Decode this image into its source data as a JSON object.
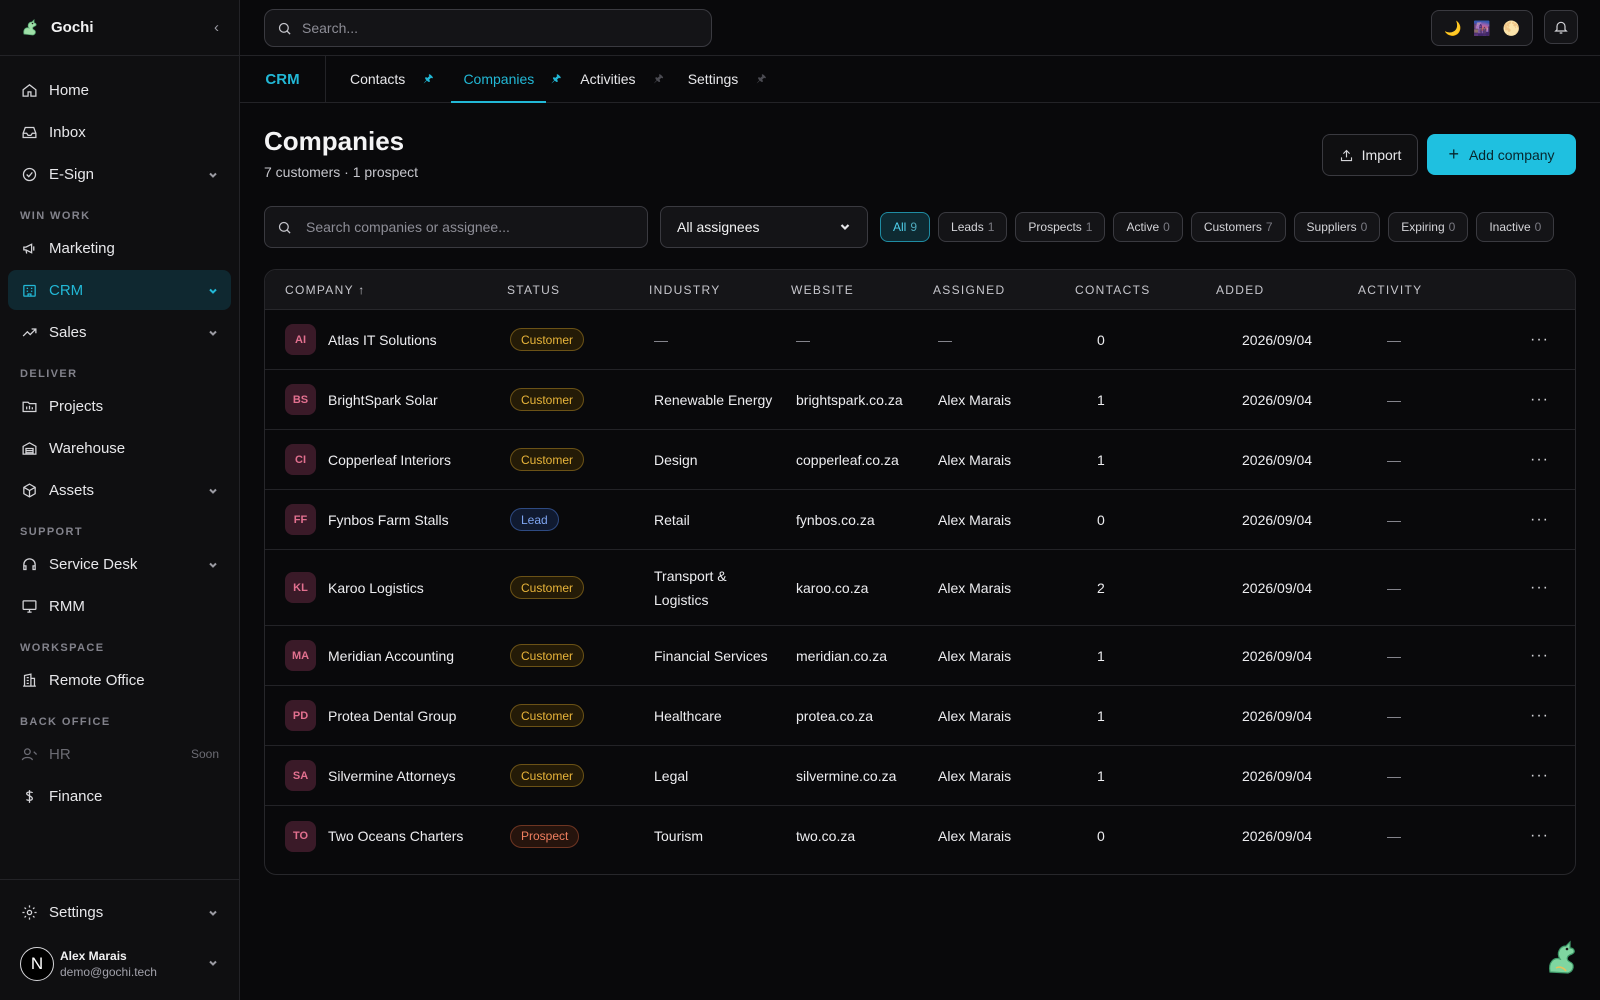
{
  "app": {
    "name": "Gochi"
  },
  "sidebar": {
    "main": [
      {
        "label": "Home",
        "icon": "home-icon"
      },
      {
        "label": "Inbox",
        "icon": "inbox-icon"
      },
      {
        "label": "E-Sign",
        "icon": "check-circle-icon"
      }
    ],
    "sections": {
      "win_work": "WIN WORK",
      "deliver": "DELIVER",
      "support": "SUPPORT",
      "workspace": "WORKSPACE",
      "back_office": "BACK OFFICE"
    },
    "win_work": [
      {
        "label": "Marketing",
        "icon": "megaphone-icon"
      },
      {
        "label": "CRM",
        "icon": "building-icon"
      },
      {
        "label": "Sales",
        "icon": "trend-up-icon"
      }
    ],
    "deliver": [
      {
        "label": "Projects",
        "icon": "folder-icon"
      },
      {
        "label": "Warehouse",
        "icon": "warehouse-icon"
      },
      {
        "label": "Assets",
        "icon": "box-icon"
      }
    ],
    "support": [
      {
        "label": "Service Desk",
        "icon": "headset-icon"
      },
      {
        "label": "RMM",
        "icon": "monitor-icon"
      }
    ],
    "workspace": [
      {
        "label": "Remote Office",
        "icon": "office-icon"
      }
    ],
    "back_office": [
      {
        "label": "HR",
        "icon": "user-icon",
        "tag": "Soon"
      },
      {
        "label": "Finance",
        "icon": "dollar-icon"
      }
    ],
    "settings": {
      "label": "Settings"
    },
    "user": {
      "initial": "N",
      "name": "Alex Marais",
      "email": "demo@gochi.tech"
    }
  },
  "topbar": {
    "search_placeholder": "Search...",
    "theme_icons": [
      "🌙",
      "🌆",
      "🌕"
    ]
  },
  "tabs": {
    "module": "CRM",
    "items": [
      {
        "label": "Contacts",
        "pinned": true
      },
      {
        "label": "Companies",
        "pinned": true,
        "active": true
      },
      {
        "label": "Activities",
        "pinned": false
      },
      {
        "label": "Settings",
        "pinned": false
      }
    ]
  },
  "page": {
    "title": "Companies",
    "subtitle": "7 customers · 1 prospect",
    "import_label": "Import",
    "add_label": "Add company"
  },
  "filters": {
    "search_placeholder": "Search companies or assignee...",
    "assignee": "All assignees",
    "chips": [
      {
        "label": "All",
        "count": "9",
        "active": true
      },
      {
        "label": "Leads",
        "count": "1"
      },
      {
        "label": "Prospects",
        "count": "1"
      },
      {
        "label": "Active",
        "count": "0"
      },
      {
        "label": "Customers",
        "count": "7"
      },
      {
        "label": "Suppliers",
        "count": "0"
      },
      {
        "label": "Expiring",
        "count": "0"
      },
      {
        "label": "Inactive",
        "count": "0"
      }
    ]
  },
  "table": {
    "columns": [
      "COMPANY ↑",
      "STATUS",
      "INDUSTRY",
      "WEBSITE",
      "ASSIGNED",
      "CONTACTS",
      "ADDED",
      "ACTIVITY"
    ],
    "rows": [
      {
        "initials": "AI",
        "company": "Atlas IT Solutions",
        "status": "Customer",
        "industry": "—",
        "website": "—",
        "assigned": "—",
        "contacts": "0",
        "added": "2026/09/04",
        "activity": "—"
      },
      {
        "initials": "BS",
        "company": "BrightSpark Solar",
        "status": "Customer",
        "industry": "Renewable Energy",
        "website": "brightspark.co.za",
        "assigned": "Alex Marais",
        "contacts": "1",
        "added": "2026/09/04",
        "activity": "—"
      },
      {
        "initials": "CI",
        "company": "Copperleaf Interiors",
        "status": "Customer",
        "industry": "Design",
        "website": "copperleaf.co.za",
        "assigned": "Alex Marais",
        "contacts": "1",
        "added": "2026/09/04",
        "activity": "—"
      },
      {
        "initials": "FF",
        "company": "Fynbos Farm Stalls",
        "status": "Lead",
        "industry": "Retail",
        "website": "fynbos.co.za",
        "assigned": "Alex Marais",
        "contacts": "0",
        "added": "2026/09/04",
        "activity": "—"
      },
      {
        "initials": "KL",
        "company": "Karoo Logistics",
        "status": "Customer",
        "industry": "Transport & Logistics",
        "website": "karoo.co.za",
        "assigned": "Alex Marais",
        "contacts": "2",
        "added": "2026/09/04",
        "activity": "—"
      },
      {
        "initials": "MA",
        "company": "Meridian Accounting",
        "status": "Customer",
        "industry": "Financial Services",
        "website": "meridian.co.za",
        "assigned": "Alex Marais",
        "contacts": "1",
        "added": "2026/09/04",
        "activity": "—"
      },
      {
        "initials": "PD",
        "company": "Protea Dental Group",
        "status": "Customer",
        "industry": "Healthcare",
        "website": "protea.co.za",
        "assigned": "Alex Marais",
        "contacts": "1",
        "added": "2026/09/04",
        "activity": "—"
      },
      {
        "initials": "SA",
        "company": "Silvermine Attorneys",
        "status": "Customer",
        "industry": "Legal",
        "website": "silvermine.co.za",
        "assigned": "Alex Marais",
        "contacts": "1",
        "added": "2026/09/04",
        "activity": "—"
      },
      {
        "initials": "TO",
        "company": "Two Oceans Charters",
        "status": "Prospect",
        "industry": "Tourism",
        "website": "two.co.za",
        "assigned": "Alex Marais",
        "contacts": "0",
        "added": "2026/09/04",
        "activity": "—"
      }
    ]
  }
}
